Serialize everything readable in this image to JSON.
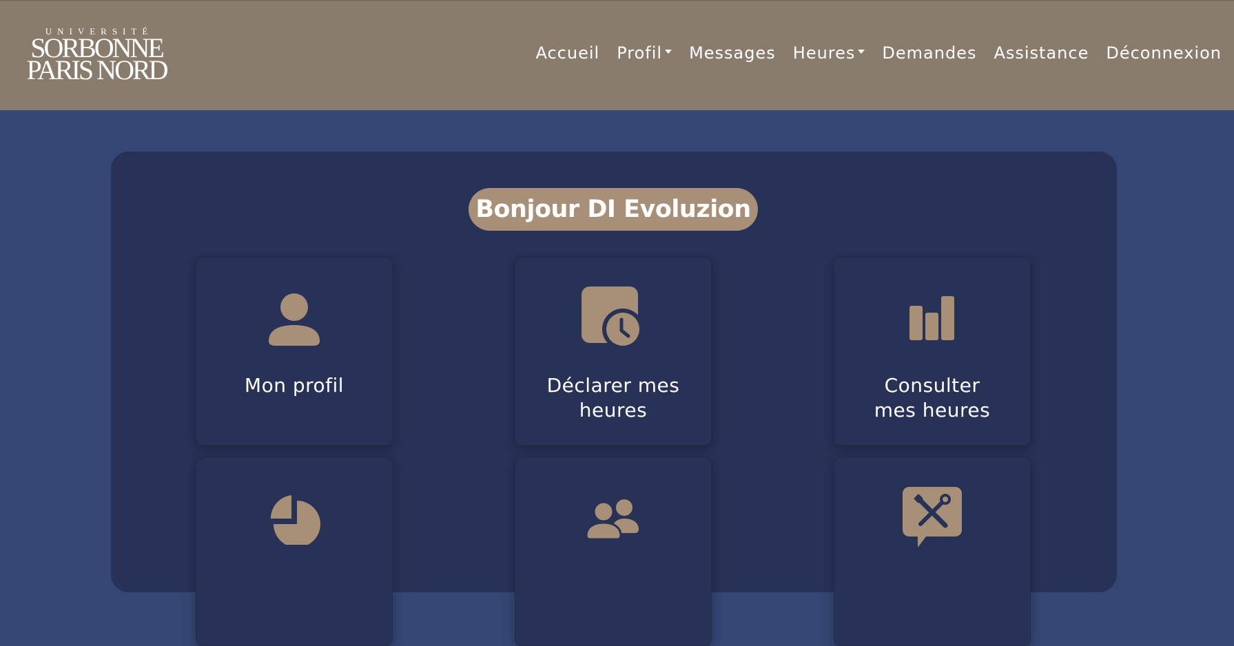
{
  "brand": {
    "logo_line1": "UNIVERSITÉ",
    "logo_line2": "SORBONNE",
    "logo_line3": "PARIS NORD"
  },
  "nav": {
    "items": [
      {
        "label": "Accueil"
      },
      {
        "label": "Profil"
      },
      {
        "label": "Messages"
      },
      {
        "label": "Heures"
      },
      {
        "label": "Demandes"
      },
      {
        "label": "Assistance"
      },
      {
        "label": "Déconnexion"
      }
    ]
  },
  "greeting": "Bonjour DI Evoluzion",
  "cards": [
    {
      "label": "Mon profil",
      "icon": "person-icon"
    },
    {
      "label": "Déclarer mes\nheures",
      "icon": "calendar-clock-icon"
    },
    {
      "label": "Consulter\nmes heures",
      "icon": "bar-chart-icon"
    },
    {
      "label": "",
      "icon": "pie-chart-icon"
    },
    {
      "label": "",
      "icon": "people-icon"
    },
    {
      "label": "",
      "icon": "tools-chat-icon"
    }
  ],
  "colors": {
    "header_bg": "#8a7c6d",
    "page_bg": "#344673",
    "panel_bg": "#283257",
    "accent": "#a88f77",
    "text": "#ffffff"
  }
}
